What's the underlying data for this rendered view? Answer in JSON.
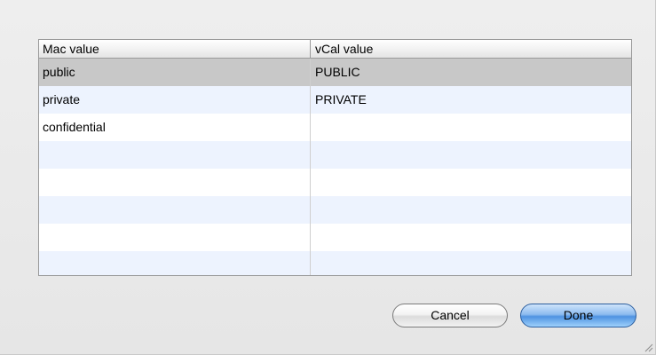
{
  "table": {
    "columns": [
      "Mac value",
      "vCal value"
    ],
    "rows": [
      {
        "mac": "public",
        "vcal": "PUBLIC",
        "selected": true
      },
      {
        "mac": "private",
        "vcal": "PRIVATE",
        "selected": false
      },
      {
        "mac": "confidential",
        "vcal": "",
        "selected": false
      },
      {
        "mac": "",
        "vcal": "",
        "selected": false
      },
      {
        "mac": "",
        "vcal": "",
        "selected": false
      },
      {
        "mac": "",
        "vcal": "",
        "selected": false
      },
      {
        "mac": "",
        "vcal": "",
        "selected": false
      },
      {
        "mac": "",
        "vcal": "",
        "selected": false
      }
    ]
  },
  "buttons": {
    "cancel_label": "Cancel",
    "done_label": "Done"
  },
  "colors": {
    "selected_row": "#c8c8c8",
    "alternate_row": "#edf3fe",
    "default_button": "#4f93e2"
  }
}
